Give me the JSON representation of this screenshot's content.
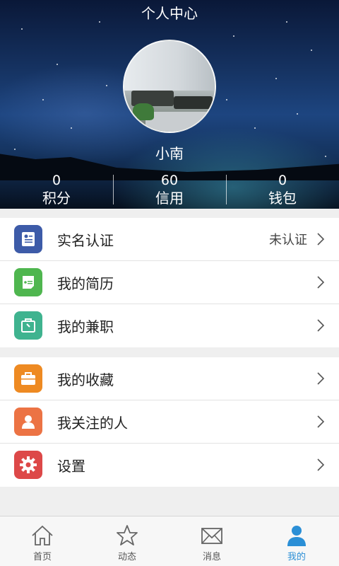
{
  "header": {
    "title": "个人中心",
    "user_name": "小南",
    "stats": [
      {
        "value": "0",
        "label": "积分"
      },
      {
        "value": "60",
        "label": "信用"
      },
      {
        "value": "0",
        "label": "钱包"
      }
    ]
  },
  "menu_group_1": [
    {
      "label": "实名认证",
      "value": "未认证",
      "icon": "id-card-icon",
      "color": "#3d5ba8"
    },
    {
      "label": "我的简历",
      "value": "",
      "icon": "resume-icon",
      "color": "#4fb64f"
    },
    {
      "label": "我的兼职",
      "value": "",
      "icon": "part-time-job-icon",
      "color": "#3fb38f"
    }
  ],
  "menu_group_2": [
    {
      "label": "我的收藏",
      "value": "",
      "icon": "briefcase-icon",
      "color": "#ee8a22"
    },
    {
      "label": "我关注的人",
      "value": "",
      "icon": "person-icon",
      "color": "#ec7344"
    },
    {
      "label": "设置",
      "value": "",
      "icon": "settings-gear-icon",
      "color": "#dd4848"
    }
  ],
  "tabbar": [
    {
      "label": "首页",
      "icon": "home-icon",
      "active": false
    },
    {
      "label": "动态",
      "icon": "star-icon",
      "active": false
    },
    {
      "label": "消息",
      "icon": "mail-icon",
      "active": false
    },
    {
      "label": "我的",
      "icon": "profile-icon",
      "active": true
    }
  ],
  "colors": {
    "accent": "#2b8fd6",
    "chevron": "#555555"
  }
}
